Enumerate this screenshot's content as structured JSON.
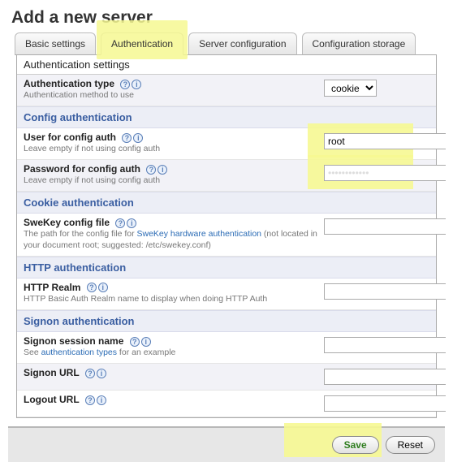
{
  "title": "Add a new server",
  "tabs": [
    {
      "label": "Basic settings"
    },
    {
      "label": "Authentication"
    },
    {
      "label": "Server configuration"
    },
    {
      "label": "Configuration storage"
    }
  ],
  "active_tab": 1,
  "panel_header": "Authentication settings",
  "auth_type": {
    "label": "Authentication type",
    "desc": "Authentication method to use",
    "value": "cookie"
  },
  "sections": {
    "config": "Config authentication",
    "cookie": "Cookie authentication",
    "http": "HTTP authentication",
    "signon": "Signon authentication"
  },
  "fields": {
    "user": {
      "label": "User for config auth",
      "desc": "Leave empty if not using config auth",
      "value": "root"
    },
    "password": {
      "label": "Password for config auth",
      "desc": "Leave empty if not using config auth",
      "value": ""
    },
    "swekey": {
      "label": "SweKey config file",
      "desc_pre": "The path for the config file for ",
      "desc_link": "SweKey hardware authentication",
      "desc_post": " (not located in your document root; suggested: /etc/swekey.conf)",
      "value": ""
    },
    "realm": {
      "label": "HTTP Realm",
      "desc": "HTTP Basic Auth Realm name to display when doing HTTP Auth",
      "value": ""
    },
    "signon_name": {
      "label": "Signon session name",
      "desc_pre": "See ",
      "desc_link": "authentication types",
      "desc_post": " for an example",
      "value": ""
    },
    "signon_url": {
      "label": "Signon URL",
      "value": ""
    },
    "logout_url": {
      "label": "Logout URL",
      "value": ""
    }
  },
  "buttons": {
    "save": "Save",
    "reset": "Reset"
  }
}
